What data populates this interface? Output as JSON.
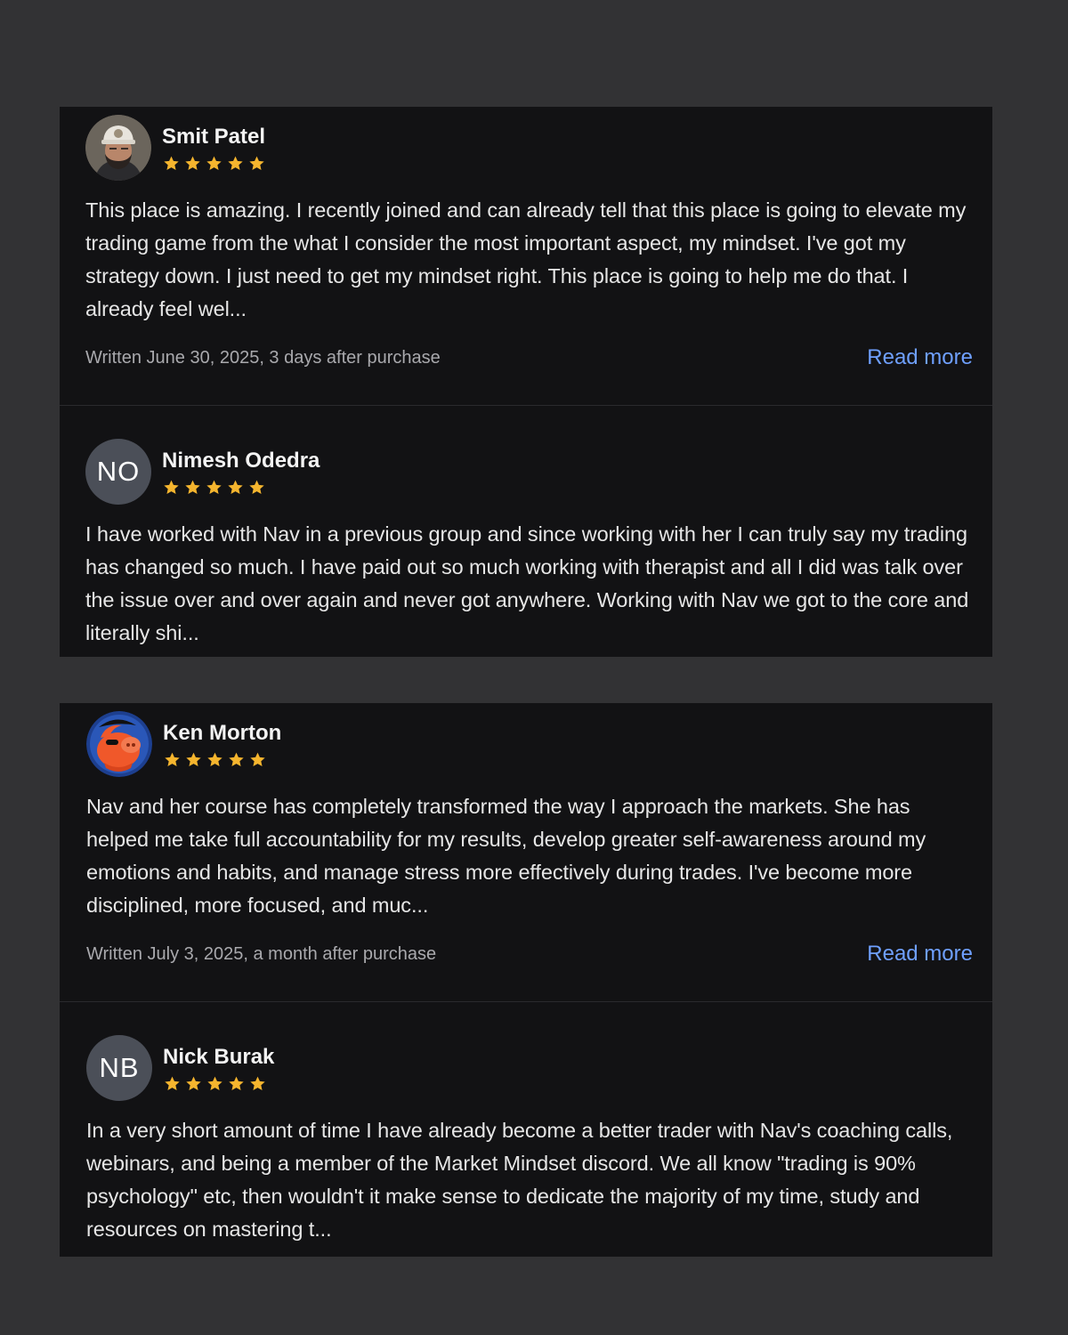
{
  "reviews": [
    {
      "name": "Smit Patel",
      "rating": 5,
      "avatar": "photo-man-cap",
      "text": "This place is amazing. I recently joined and can already tell that this place is going to elevate my trading game from the what I consider the most important aspect, my mindset. I've got my strategy down. I just need to get my mindset right. This place is going to help me do that. I already feel wel...",
      "written": "Written June 30, 2025, 3 days after purchase",
      "read_more": "Read more"
    },
    {
      "name": "Nimesh Odedra",
      "rating": 5,
      "initials": "NO",
      "text": "I have worked with Nav in a previous group and since working with her I can truly say my trading has changed so much. I have paid out so much working with therapist and all I did was talk over the issue over and over again and never got anywhere. Working with Nav we got to the core and literally shi..."
    },
    {
      "name": "Ken Morton",
      "rating": 5,
      "avatar": "cartoon-pig-pirate",
      "text": "Nav and her course has completely transformed the way I approach the markets. She has helped me take full accountability for my results, develop greater self-awareness around my emotions and habits, and manage stress more effectively during trades. I've become more disciplined, more focused, and muc...",
      "written": "Written July 3, 2025, a month after purchase",
      "read_more": "Read more"
    },
    {
      "name": "Nick Burak",
      "rating": 5,
      "initials": "NB",
      "text": "In a very short amount of time I have already become a better trader with Nav's coaching calls, webinars, and being a member of the Market Mindset discord. We all know \"trading is 90% psychology\" etc, then wouldn't it make sense to dedicate the majority of my time, study and resources on mastering t..."
    }
  ],
  "colors": {
    "background": "#323234",
    "panel": "#121214",
    "star": "#f5b52e",
    "link": "#6fa0ff"
  }
}
